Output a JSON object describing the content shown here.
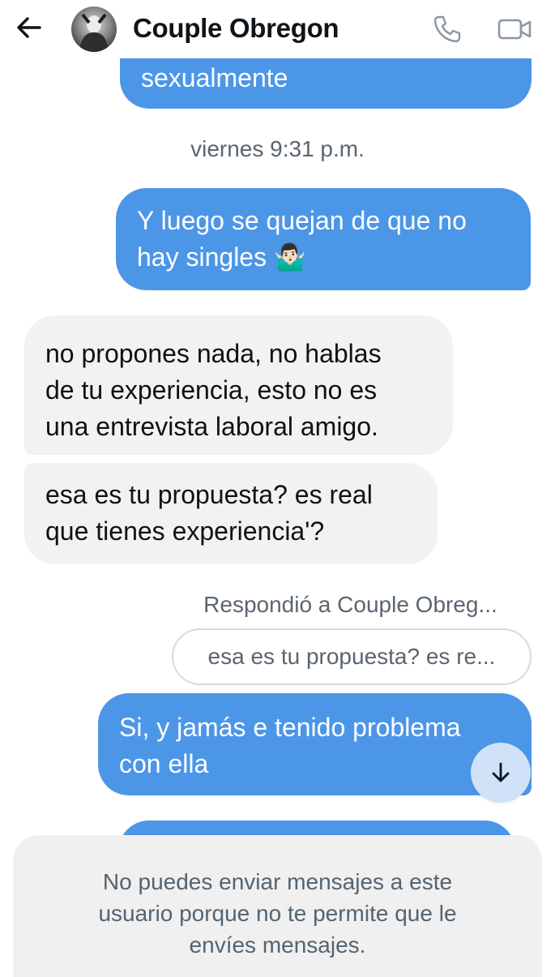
{
  "header": {
    "title": "Couple Obregon",
    "icons": {
      "back": "arrow-left-icon",
      "call": "phone-icon",
      "video": "video-camera-icon"
    }
  },
  "messages": [
    {
      "direction": "out",
      "text": "sexualmente"
    },
    {
      "direction": "out",
      "text_lines": [
        "Y luego se quejan de que no",
        "hay singles 🤷🏻‍♂️"
      ]
    },
    {
      "direction": "in",
      "text_lines": [
        "no propones nada, no hablas",
        "de tu experiencia, esto no es",
        "una entrevista laboral amigo."
      ]
    },
    {
      "direction": "in",
      "text_lines": [
        "esa es tu propuesta? es real",
        "que tienes experiencia'?"
      ]
    },
    {
      "direction": "out",
      "text_lines": [
        "Si, y jamás e tenido problema",
        "con ella"
      ]
    }
  ],
  "timestamp": "viernes 9:31 p.m.",
  "reply": {
    "label": "Respondió a Couple Obreg...",
    "quote": "esa es tu propuesta? es re..."
  },
  "scroll_button": {
    "icon": "arrow-down-icon"
  },
  "notice": {
    "text_lines": [
      "No puedes enviar mensajes a este",
      "usuario porque no te permite que le",
      "envíes mensajes."
    ]
  },
  "colors": {
    "outgoing_bubble": "#4c96e8",
    "incoming_bubble": "#f2f2f2",
    "scroll_button": "#cfe2f8",
    "notice_background": "#f0f0f0",
    "meta_text": "#5b6570"
  }
}
